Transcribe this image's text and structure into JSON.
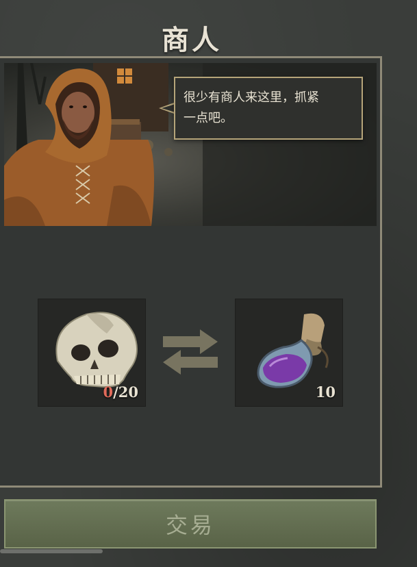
{
  "header": {
    "title": "商人"
  },
  "dialogue": {
    "text_line1": "很少有商人来这里，抓紧",
    "text_line2": "一点吧。"
  },
  "trade": {
    "give": {
      "item_icon": "skull-icon",
      "owned": "0",
      "required": "/20"
    },
    "receive": {
      "item_icon": "purple-potion-icon",
      "quantity": "10"
    }
  },
  "actions": {
    "trade_label": "交易"
  },
  "colors": {
    "accent_gold": "#b6a57a",
    "button_green": "#6e7a5c",
    "warning_red": "#e06a5a"
  }
}
